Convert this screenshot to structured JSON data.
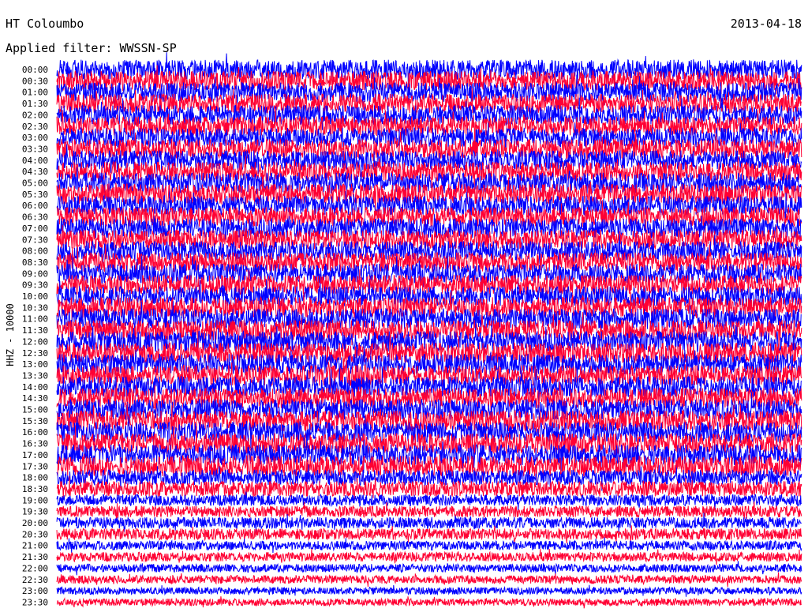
{
  "header": {
    "station": "HT Coloumbo",
    "date": "2013-04-18",
    "filter": "Applied filter: WWSSN-SP"
  },
  "chart_data": {
    "type": "line",
    "ylabel": "HHZ - 10000",
    "y_ticks": [
      "00:00",
      "00:30",
      "01:00",
      "01:30",
      "02:00",
      "02:30",
      "03:00",
      "03:30",
      "04:00",
      "04:30",
      "05:00",
      "05:30",
      "06:00",
      "06:30",
      "07:00",
      "07:30",
      "08:00",
      "08:30",
      "09:00",
      "09:30",
      "10:00",
      "10:30",
      "11:00",
      "11:30",
      "12:00",
      "12:30",
      "13:00",
      "13:30",
      "14:00",
      "14:30",
      "15:00",
      "15:30",
      "16:00",
      "16:30",
      "17:00",
      "17:30",
      "18:00",
      "18:30",
      "19:00",
      "19:30",
      "20:00",
      "20:30",
      "21:00",
      "21:30",
      "22:00",
      "22:30",
      "23:00",
      "23:30"
    ],
    "trace_colors": [
      "#0000ff",
      "#ff0033"
    ],
    "amplitude_by_trace": [
      0.95,
      0.95,
      0.95,
      0.95,
      0.95,
      0.95,
      0.95,
      0.95,
      0.95,
      0.95,
      1.0,
      1.0,
      0.95,
      0.95,
      0.95,
      0.95,
      0.95,
      0.95,
      0.95,
      0.95,
      0.95,
      1.0,
      1.0,
      1.0,
      1.0,
      1.0,
      1.0,
      1.0,
      1.0,
      1.0,
      1.0,
      1.0,
      1.0,
      1.0,
      1.0,
      1.0,
      0.75,
      0.75,
      0.55,
      0.55,
      0.55,
      0.55,
      0.45,
      0.45,
      0.4,
      0.4,
      0.35,
      0.35
    ],
    "grid": false,
    "legend": "none"
  }
}
